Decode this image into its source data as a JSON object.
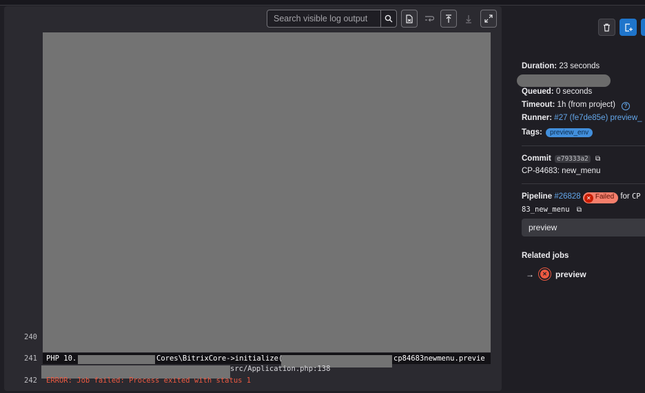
{
  "log": {
    "search_placeholder": "Search visible log output",
    "lines": [
      {
        "number": "240",
        "text": ""
      },
      {
        "number": "241",
        "segments": [
          "PHP  10.",
          "Cores\\BitrixCore->initialize()",
          "cp84683newmenu.previe",
          "src/Application.php:138"
        ]
      },
      {
        "number": "242",
        "text": "ERROR: Job failed: Process exited with status 1"
      }
    ]
  },
  "sidebar": {
    "duration_label": "Duration:",
    "duration_value": "23 seconds",
    "queued_label": "Queued:",
    "queued_value": "0 seconds",
    "timeout_label": "Timeout:",
    "timeout_value": "1h (from project)",
    "runner_label": "Runner:",
    "runner_value": "#27 (fe7de85e) preview_",
    "tags_label": "Tags:",
    "tag": "preview_env",
    "commit_label": "Commit",
    "commit_sha": "e79333a2",
    "commit_message": "CP-84683: new_menu",
    "pipeline_label": "Pipeline",
    "pipeline_id": "#26828",
    "pipeline_status": "Failed",
    "pipeline_for": "for",
    "pipeline_ref_start": "CP",
    "pipeline_ref_end": "83_new_menu",
    "stage": "preview",
    "related_jobs_label": "Related jobs",
    "related_job_arrow": "→",
    "related_job_name": "preview"
  },
  "colors": {
    "error": "#ec5941",
    "link": "#63a6e9",
    "primary_button": "#1f75cb"
  },
  "icons": [
    "search-icon",
    "raw-log-icon",
    "wrap-lines-icon",
    "scroll-to-top-icon",
    "scroll-to-bottom-icon",
    "fullscreen-icon",
    "trash-icon",
    "new-issue-icon",
    "help-icon",
    "copy-icon",
    "status-failed-icon"
  ]
}
